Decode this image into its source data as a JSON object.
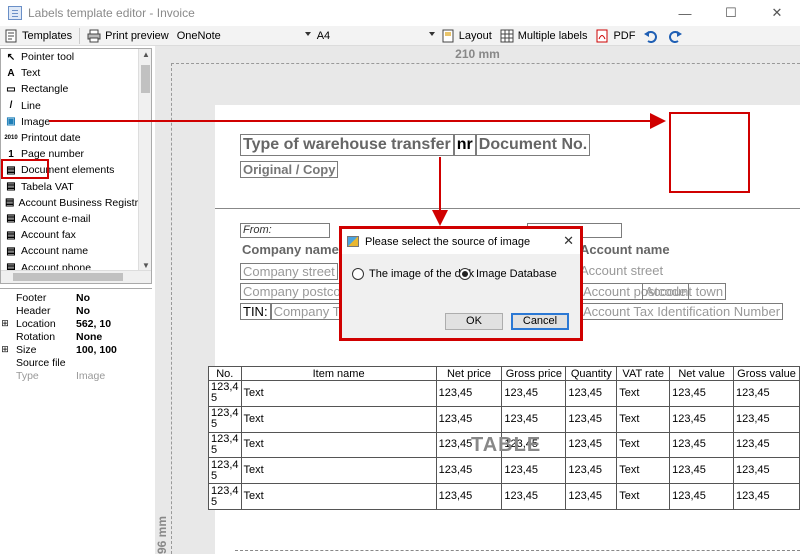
{
  "window": {
    "title": "Labels template editor - Invoice"
  },
  "toolbar": {
    "templates": "Templates",
    "print_preview": "Print preview",
    "printer": "OneNote",
    "paper": "A4",
    "layout": "Layout",
    "multiple_labels": "Multiple labels",
    "pdf": "PDF"
  },
  "tools": [
    {
      "label": "Pointer tool",
      "icon": "↖"
    },
    {
      "label": "Text",
      "icon": "A"
    },
    {
      "label": "Rectangle",
      "icon": "▭"
    },
    {
      "label": "Line",
      "icon": "/"
    },
    {
      "label": "Image",
      "icon": "▣"
    },
    {
      "label": "Printout date",
      "icon": "2010"
    },
    {
      "label": "Page number",
      "icon": "1"
    },
    {
      "label": "Document elements",
      "icon": "▤"
    },
    {
      "label": "Tabela VAT",
      "icon": "▤"
    },
    {
      "label": "Account Business Registry ...",
      "icon": "▤"
    },
    {
      "label": "Account e-mail",
      "icon": "▤"
    },
    {
      "label": "Account fax",
      "icon": "▤"
    },
    {
      "label": "Account name",
      "icon": "▤"
    },
    {
      "label": "Account phone",
      "icon": "▤"
    }
  ],
  "properties": [
    {
      "key": "Footer",
      "value": "No",
      "expandable": false,
      "dim": false
    },
    {
      "key": "Header",
      "value": "No",
      "expandable": false,
      "dim": false
    },
    {
      "key": "Location",
      "value": "562, 10",
      "expandable": true,
      "dim": false
    },
    {
      "key": "Rotation",
      "value": "None",
      "expandable": false,
      "dim": false
    },
    {
      "key": "Size",
      "value": "100, 100",
      "expandable": true,
      "dim": false
    },
    {
      "key": "Source file",
      "value": "",
      "expandable": false,
      "dim": false
    },
    {
      "key": "Type",
      "value": "Image",
      "expandable": false,
      "dim": true
    }
  ],
  "rulers": {
    "top": "210 mm",
    "left": "96 mm"
  },
  "document": {
    "title_label": "Type of warehouse transfer",
    "nr_label": "nr",
    "doc_no": "Document No.",
    "original_copy": "Original / Copy",
    "from": "From:",
    "company_name": "Company name",
    "company_street": "Company street",
    "company_postcode": "Company postcode",
    "tin_label": "TIN:",
    "company_tin": "Company Tax Identification Number",
    "account_name": "Account name",
    "account_street": "Account street",
    "account_postcode": "Account postcode",
    "account_town": "Account town",
    "account_tin": "Account Tax Identification Number"
  },
  "table": {
    "label": "TABLE",
    "headers": [
      "No.",
      "Item name",
      "Net price",
      "Gross price",
      "Quantity",
      "VAT rate",
      "Net value",
      "Gross value"
    ],
    "rows": [
      [
        "123,4 5",
        "Text",
        "123,45",
        "123,45",
        "123,45",
        "Text",
        "123,45",
        "123,45"
      ],
      [
        "123,4 5",
        "Text",
        "123,45",
        "123,45",
        "123,45",
        "Text",
        "123,45",
        "123,45"
      ],
      [
        "123,4 5",
        "Text",
        "123,45",
        "123,45",
        "123,45",
        "Text",
        "123,45",
        "123,45"
      ],
      [
        "123,4 5",
        "Text",
        "123,45",
        "123,45",
        "123,45",
        "Text",
        "123,45",
        "123,45"
      ],
      [
        "123,4 5",
        "Text",
        "123,45",
        "123,45",
        "123,45",
        "Text",
        "123,45",
        "123,45"
      ]
    ]
  },
  "dialog": {
    "title": "Please select the source of image",
    "option_disk": "The image of the disk",
    "option_database": "Image Database",
    "selected": "Image Database",
    "ok": "OK",
    "cancel": "Cancel"
  },
  "colors": {
    "highlight": "#d00000",
    "accent": "#2b78d4"
  }
}
